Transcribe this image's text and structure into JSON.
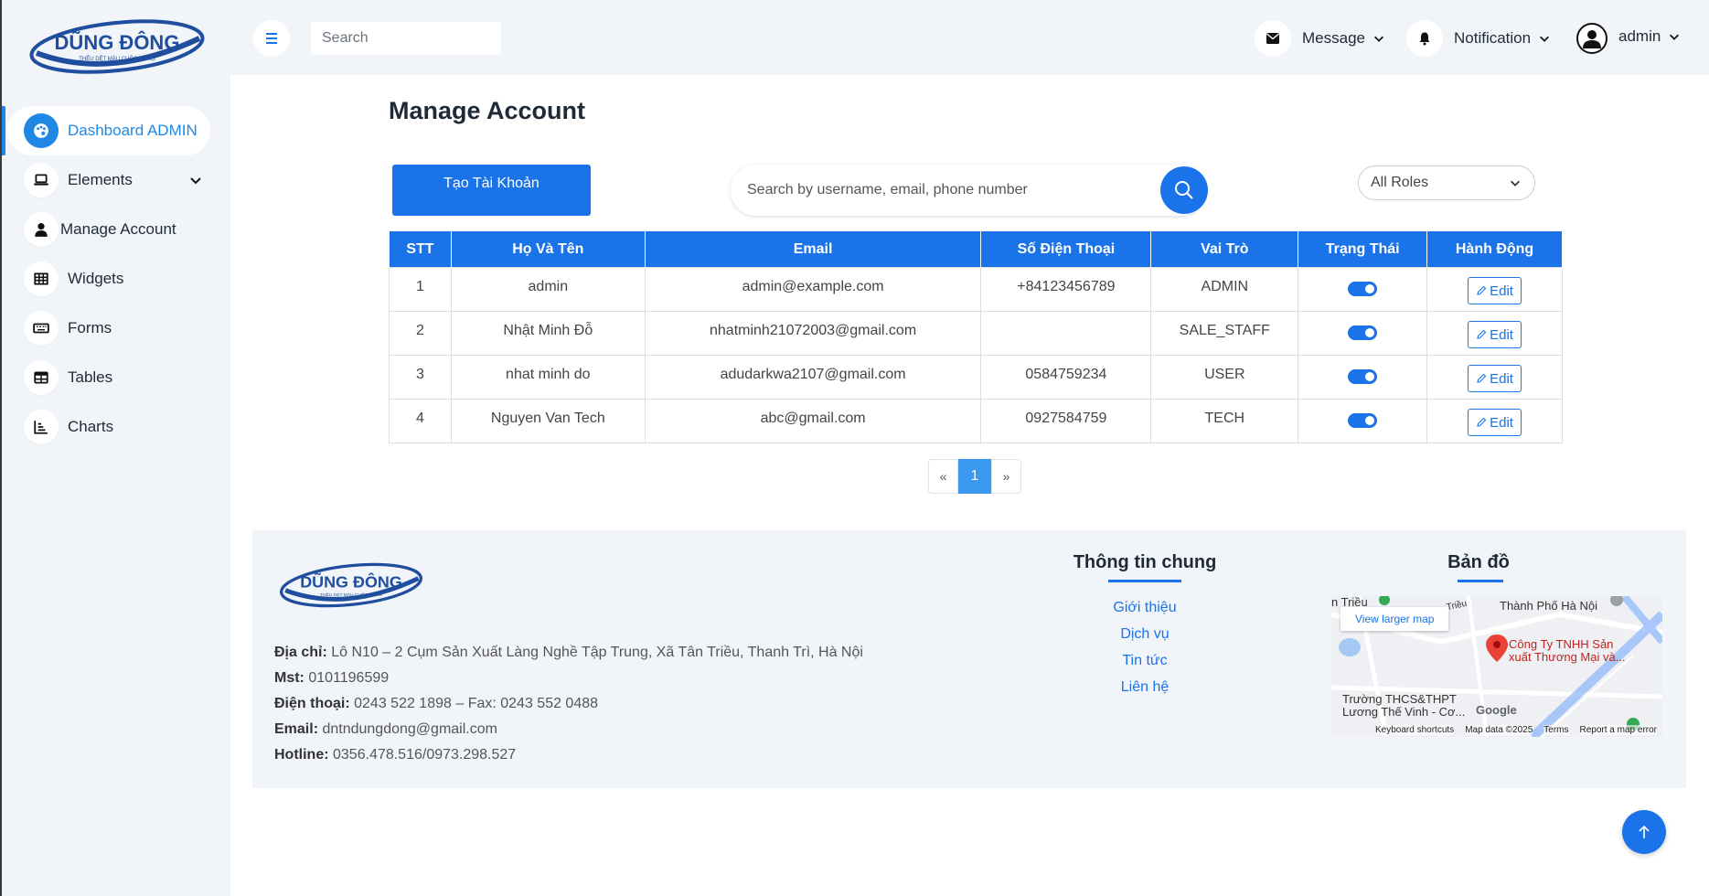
{
  "brand": {
    "logo_text": "DŨNG ĐÔNG",
    "logo_tagline": "THÊU DỆT MÀU CUỘC SỐNG",
    "colors": {
      "primary": "#1a73e8",
      "sidebar_bg": "#f1f4f8",
      "logo_blue": "#1f4e9e"
    }
  },
  "sidebar": {
    "items": [
      {
        "label": "Dashboard ADMIN",
        "icon": "palette-icon",
        "active": true
      },
      {
        "label": "Elements",
        "icon": "laptop-icon",
        "has_submenu": true
      },
      {
        "label": "Manage Account",
        "icon": "user-icon"
      },
      {
        "label": "Widgets",
        "icon": "grid-icon"
      },
      {
        "label": "Forms",
        "icon": "keyboard-icon"
      },
      {
        "label": "Tables",
        "icon": "table-icon"
      },
      {
        "label": "Charts",
        "icon": "chart-icon"
      }
    ]
  },
  "topbar": {
    "search_placeholder": "Search",
    "message_label": "Message",
    "notification_label": "Notification",
    "user_label": "admin"
  },
  "main": {
    "title": "Manage Account",
    "create_button": "Tạo Tài Khoản",
    "search_placeholder": "Search by username, email, phone number",
    "role_filter": "All Roles",
    "table": {
      "headers": [
        "STT",
        "Họ Và Tên",
        "Email",
        "Số Điện Thoại",
        "Vai Trò",
        "Trạng Thái",
        "Hành Động"
      ],
      "rows": [
        {
          "stt": "1",
          "name": "admin",
          "email": "admin@example.com",
          "phone": "+84123456789",
          "role": "ADMIN",
          "active": true,
          "action": "Edit"
        },
        {
          "stt": "2",
          "name": "Nhật Minh Đỗ",
          "email": "nhatminh21072003@gmail.com",
          "phone": "",
          "role": "SALE_STAFF",
          "active": true,
          "action": "Edit"
        },
        {
          "stt": "3",
          "name": "nhat minh do",
          "email": "adudarkwa2107@gmail.com",
          "phone": "0584759234",
          "role": "USER",
          "active": true,
          "action": "Edit"
        },
        {
          "stt": "4",
          "name": "Nguyen Van Tech",
          "email": "abc@gmail.com",
          "phone": "0927584759",
          "role": "TECH",
          "active": true,
          "action": "Edit"
        }
      ]
    },
    "pagination": {
      "prev": "«",
      "current": "1",
      "next": "»"
    }
  },
  "footer": {
    "address_label": "Địa chỉ:",
    "address": "Lô N10 – 2 Cụm Sản Xuất Làng Nghề Tập Trung, Xã Tân Triều, Thanh Trì, Hà Nội",
    "tax_label": "Mst:",
    "tax": "0101196599",
    "phone_label": "Điện thoại:",
    "phone": "0243 522 1898 – Fax: 0243 552 0488",
    "email_label": "Email:",
    "email": "dntndungdong@gmail.com",
    "hotline_label": "Hotline:",
    "hotline": "0356.478.516/0973.298.527",
    "info_title": "Thông tin chung",
    "links": [
      "Giới thiệu",
      "Dịch vụ",
      "Tin tức",
      "Liên hệ"
    ],
    "map_title": "Bản đồ",
    "map": {
      "larger_map": "View larger map",
      "place_name": "Công Ty TNHH Sản xuất Thương Mại và...",
      "label_top_left": "n Triều",
      "label_top_right": "Thành Phố Hà Nội",
      "label_road": "Triều",
      "label_school": "Trường THCS&THPT Lương Thế Vinh - Cơ...",
      "google": "Google",
      "keyboard": "Keyboard shortcuts",
      "map_data": "Map data ©2025",
      "terms": "Terms",
      "report": "Report a map error"
    }
  }
}
